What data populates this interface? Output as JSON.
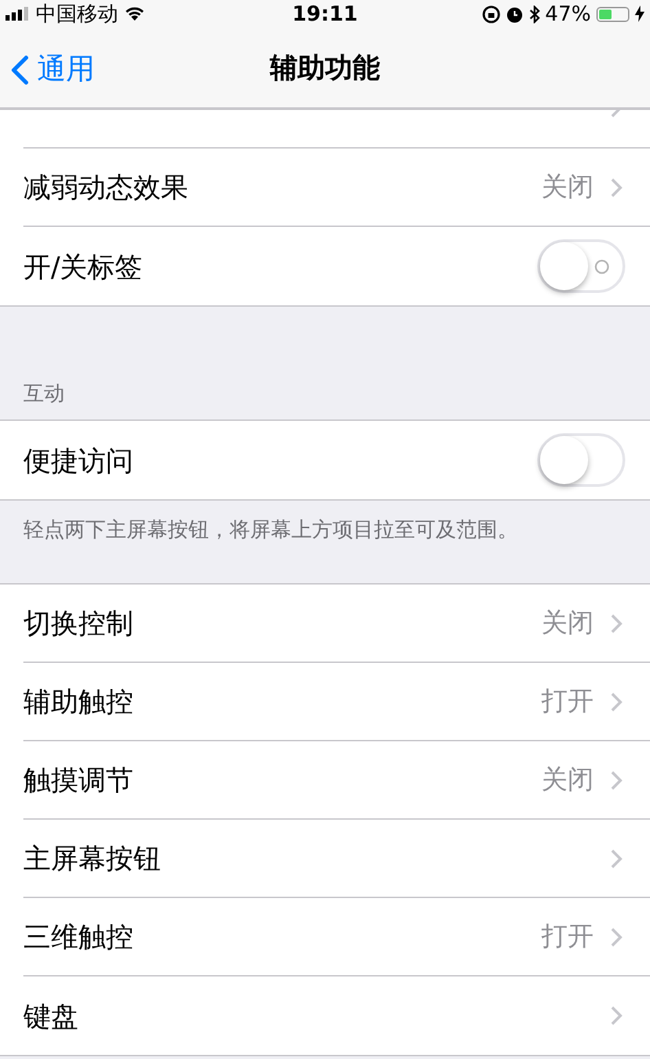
{
  "status_bar": {
    "carrier": "中国移动",
    "time": "19:11",
    "battery": "47%"
  },
  "nav": {
    "back": "通用",
    "title": "辅助功能"
  },
  "sections": [
    {
      "items": [
        {
          "kind": "partial"
        },
        {
          "kind": "value",
          "label": "减弱动态效果",
          "value": "关闭"
        },
        {
          "kind": "toggle",
          "label": "开/关标签",
          "on": false,
          "labels": true
        }
      ]
    },
    {
      "header": "互动",
      "items": [
        {
          "kind": "toggle",
          "label": "便捷访问",
          "on": false,
          "labels": false
        }
      ],
      "footer": "轻点两下主屏幕按钮，将屏幕上方项目拉至可及范围。"
    },
    {
      "items": [
        {
          "kind": "value",
          "label": "切换控制",
          "value": "关闭"
        },
        {
          "kind": "value",
          "label": "辅助触控",
          "value": "打开"
        },
        {
          "kind": "value",
          "label": "触摸调节",
          "value": "关闭"
        },
        {
          "kind": "value",
          "label": "主屏幕按钮"
        },
        {
          "kind": "value",
          "label": "三维触控",
          "value": "打开"
        },
        {
          "kind": "value",
          "label": "键盘"
        }
      ]
    }
  ]
}
